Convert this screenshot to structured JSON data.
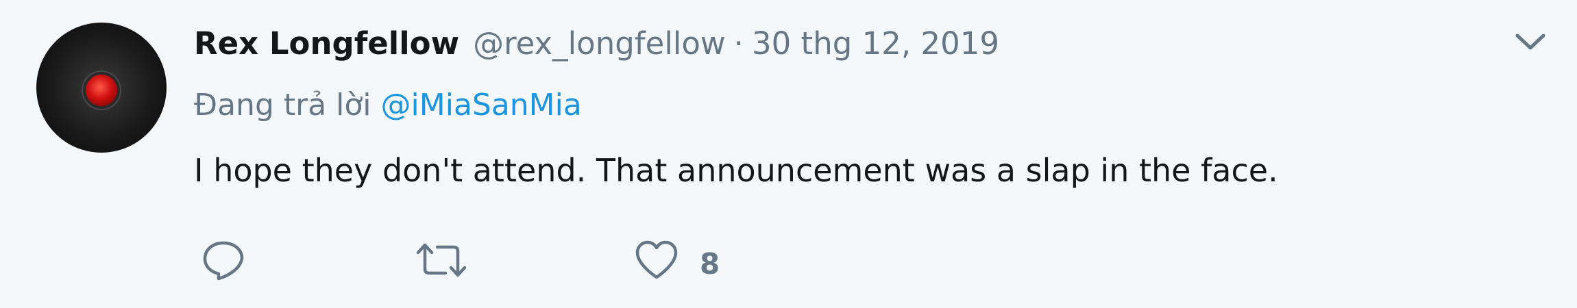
{
  "tweet": {
    "author": {
      "display_name": "Rex Longfellow",
      "handle": "@rex_longfellow"
    },
    "separator": "·",
    "timestamp": "30 thg 12, 2019",
    "reply_context": {
      "prefix": "Đang trả lời",
      "mention": "@iMiaSanMia"
    },
    "text": "I hope they don't attend. That announcement was a slap in the face.",
    "actions": {
      "reply_icon": "reply-icon",
      "retweet_icon": "retweet-icon",
      "like_icon": "heart-icon",
      "like_count": "8"
    },
    "menu_icon": "chevron-down-icon"
  },
  "colors": {
    "background": "#f5f8fa",
    "text_primary": "#14171a",
    "text_secondary": "#657786",
    "link": "#1b95e0"
  }
}
